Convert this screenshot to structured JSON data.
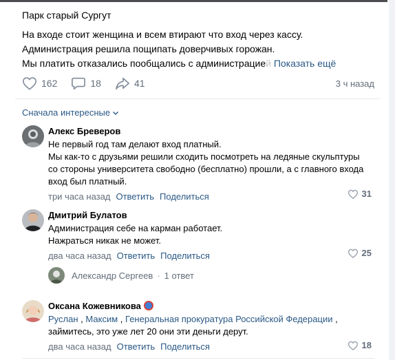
{
  "post": {
    "title": "Парк старый Сургут",
    "lines": [
      "На входе стоит женщина и всем втирают что вход через кассу.",
      "Администрация решила пощипать доверчивых горожан."
    ],
    "last_line_start": "Мы платить отказались пообщались с администрацие",
    "last_line_fade": "й",
    "show_more": "Показать ещё"
  },
  "actions": {
    "likes": "162",
    "comments": "18",
    "shares": "41",
    "time": "3 ч назад"
  },
  "sort_label": "Сначала интересные",
  "comments": [
    {
      "name": "Алекс Бреверов",
      "lines": [
        "Не первый год там делают вход платный.",
        "Мы как-то с друзьями решили сходить посмотреть на ледяные скульптуры",
        "со стороны университета свободно (бесплатно) прошли, а с главного входа",
        "вход был платный."
      ],
      "time": "три часа назад",
      "reply": "Ответить",
      "share": "Поделиться",
      "likes": "31"
    },
    {
      "name": "Дмитрий Булатов",
      "lines": [
        "Администрация себе на карман работает.",
        "Нажраться никак не может."
      ],
      "time": "два часа назад",
      "reply": "Ответить",
      "share": "Поделиться",
      "likes": "25"
    },
    {
      "name": "Оксана Кожевникова",
      "mentions": [
        "Руслан",
        "Максим",
        "Генеральная прокуратура Российской Федерации"
      ],
      "sep": ",",
      "line2": "займитесь, это уже лет 20 они эти деньги дерут.",
      "time": "два часа назад",
      "reply": "Ответить",
      "share": "Поделиться",
      "likes": "18"
    }
  ],
  "thread": {
    "name": "Александр Сергеев",
    "dot": "·",
    "replies": "1 ответ"
  },
  "colors": {
    "link": "#2a5885",
    "meta": "#626d7a",
    "heart": "#99a2ad"
  }
}
